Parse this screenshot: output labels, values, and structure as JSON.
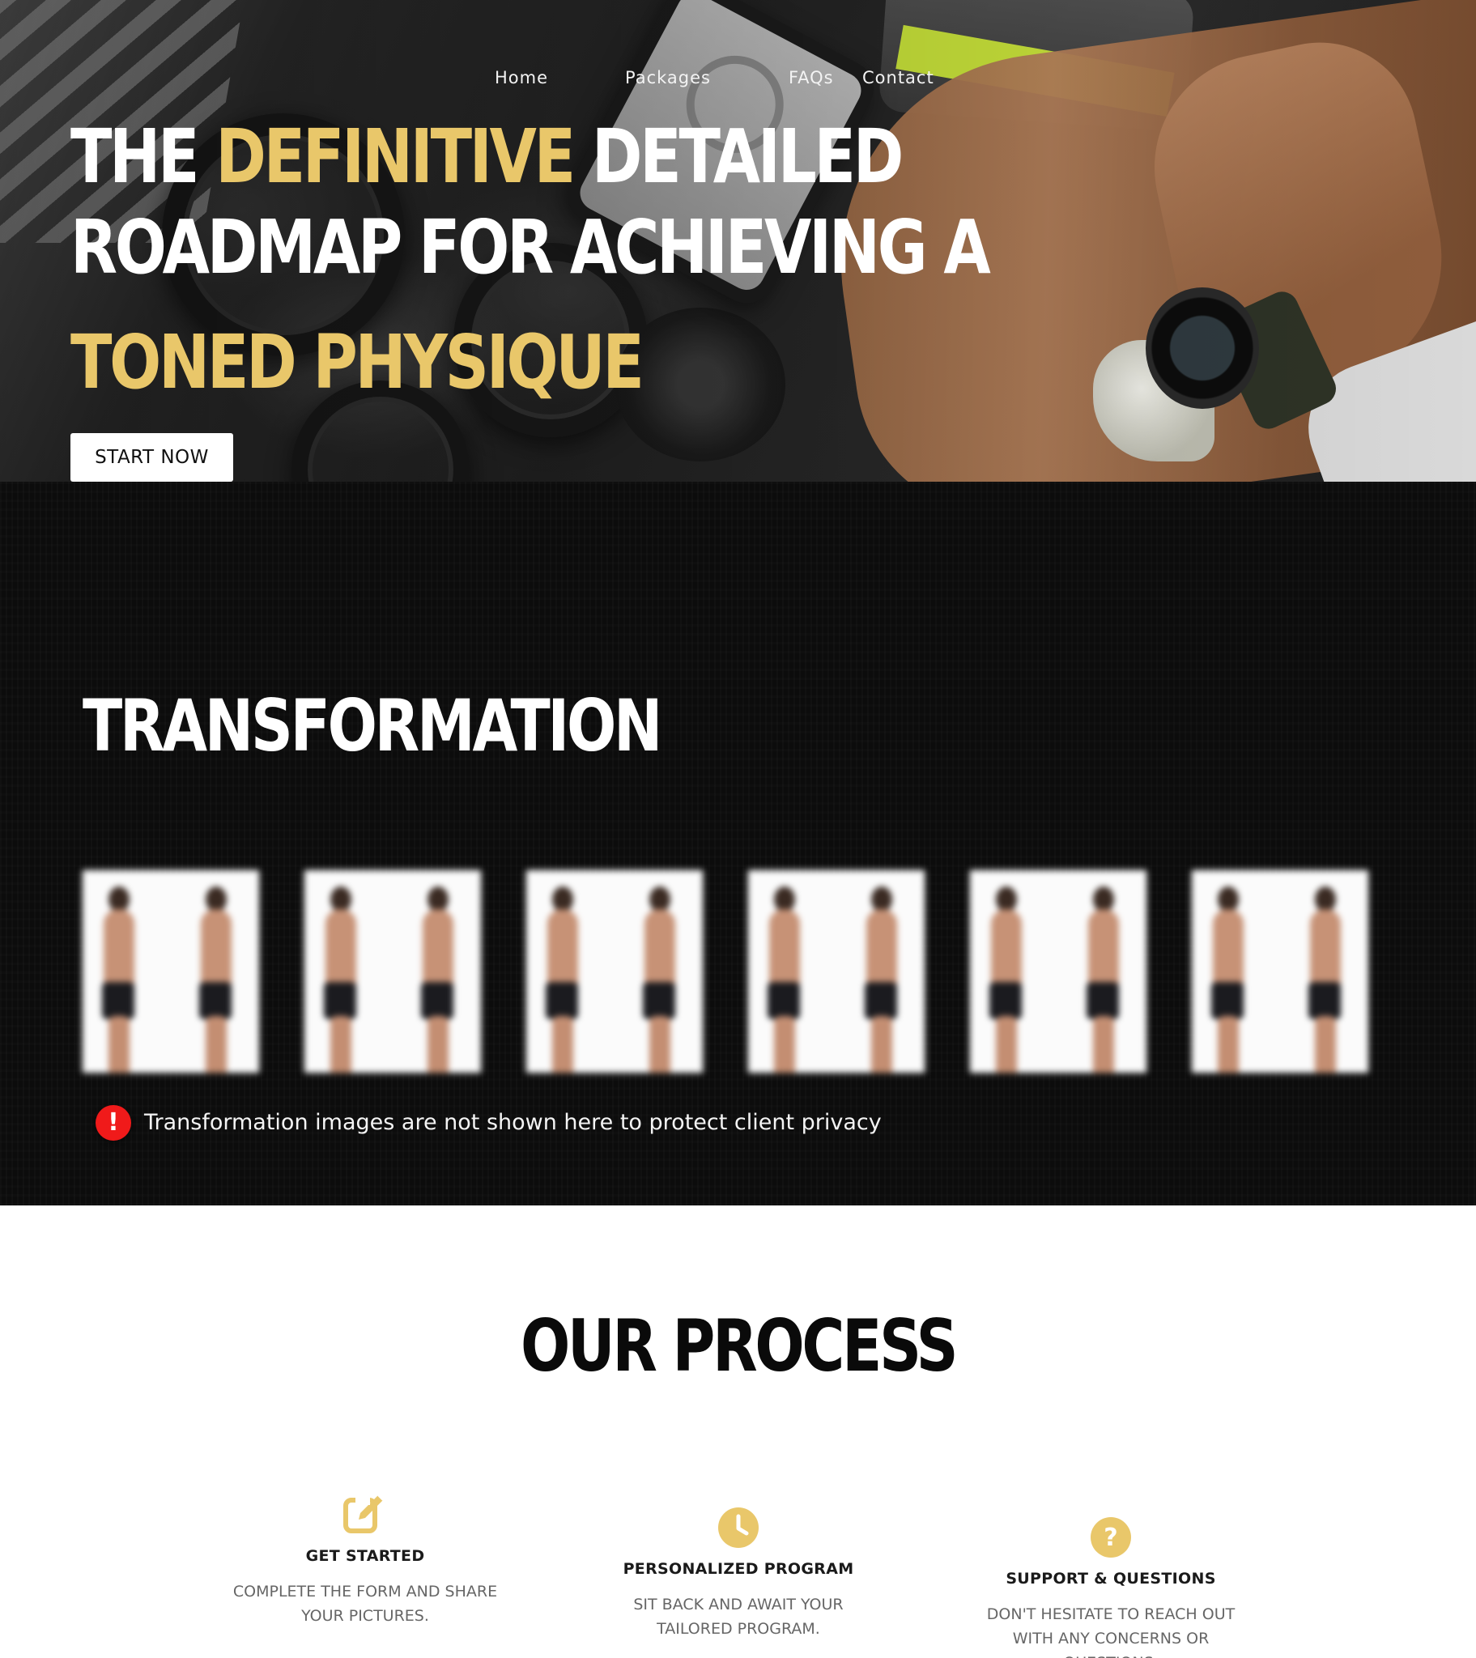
{
  "colors": {
    "accent_gold": "#e9c76a",
    "alert_red": "#f01a1a",
    "dark_bg": "#0c0c0c",
    "white": "#ffffff"
  },
  "nav": {
    "items": [
      {
        "label": "Home"
      },
      {
        "label": "Packages"
      },
      {
        "label": "FAQs"
      },
      {
        "label": "Contact"
      }
    ]
  },
  "hero": {
    "line1_pre": "THE ",
    "line1_highlight": "DEFINITIVE",
    "line1_post": " DETAILED",
    "line2": "ROADMAP FOR ACHIEVING A",
    "line3": "TONED PHYSIQUE",
    "cta_label": "START NOW"
  },
  "transformation": {
    "title": "TRANSFORMATION",
    "thumbnail_count": 6,
    "privacy_icon": "alert-icon",
    "privacy_icon_glyph": "!",
    "privacy_notice": "Transformation images are not shown here to protect client privacy"
  },
  "process": {
    "title": "OUR PROCESS",
    "steps": [
      {
        "icon": "edit-icon",
        "title": "GET STARTED",
        "description": "COMPLETE THE FORM AND SHARE YOUR PICTURES."
      },
      {
        "icon": "clock-icon",
        "title": "PERSONALIZED PROGRAM",
        "description": "SIT BACK AND AWAIT YOUR TAILORED PROGRAM."
      },
      {
        "icon": "question-icon",
        "title": "SUPPORT & QUESTIONS",
        "description": "DON'T HESITATE TO REACH OUT WITH ANY CONCERNS OR QUESTIONS."
      }
    ]
  }
}
